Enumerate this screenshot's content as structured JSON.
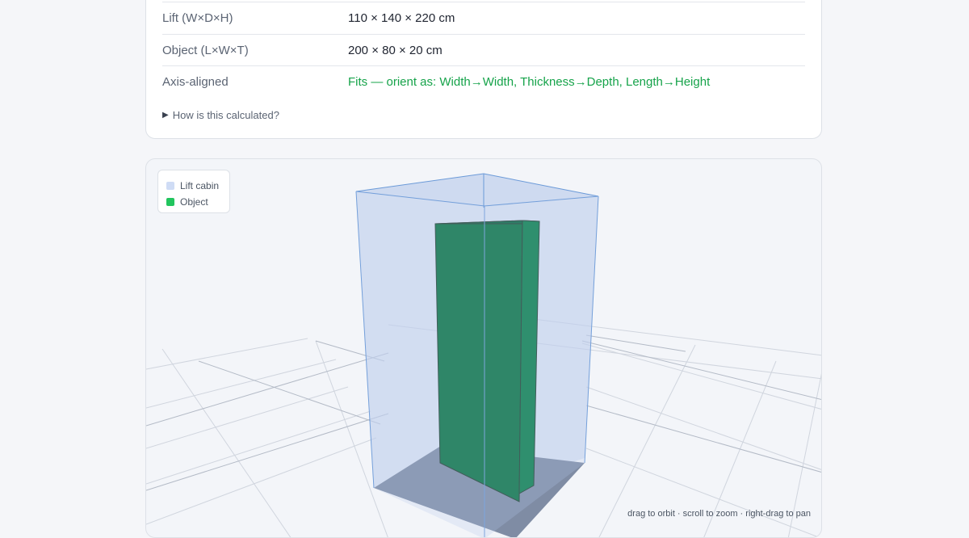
{
  "results": {
    "rows": [
      {
        "label": "Lift (W×D×H)",
        "value": "110 × 140 × 220 cm"
      },
      {
        "label": "Object (L×W×T)",
        "value": "200 × 80 × 20 cm"
      },
      {
        "label": "Axis-aligned",
        "value": "Fits — orient as: Width→Width, Thickness→Depth, Length→Height"
      }
    ],
    "details_toggle": "How is this calculated?",
    "status_color": "#16a34a"
  },
  "viewer": {
    "legend": [
      {
        "label": "Lift cabin",
        "color": "#cfdcf5"
      },
      {
        "label": "Object",
        "color": "#22c55e"
      }
    ],
    "hint": "drag to orbit · scroll to zoom · right-drag to pan",
    "object_color": "#03703d",
    "cabin_edge_color": "#6b9ad8",
    "floor_color": "#7f8ca4"
  }
}
